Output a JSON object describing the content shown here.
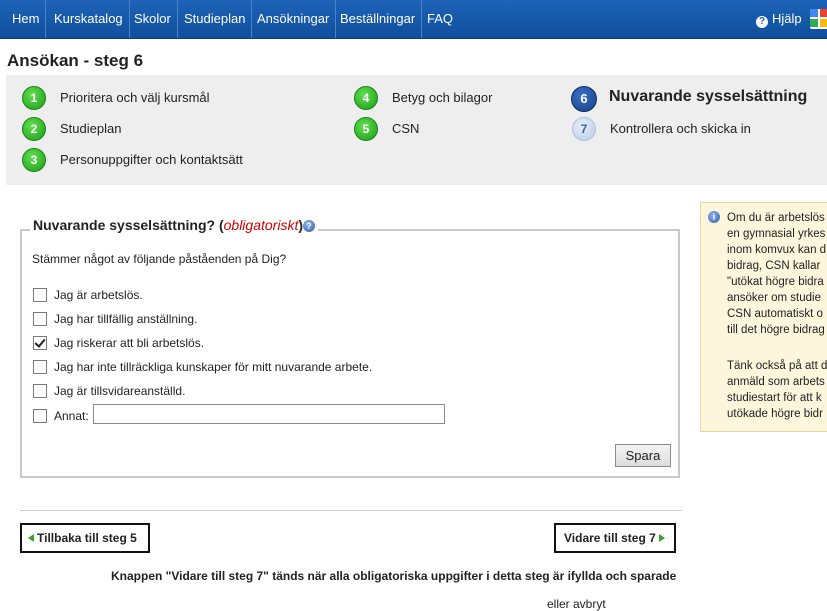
{
  "nav": {
    "items": [
      "Hem",
      "Kurskatalog",
      "Skolor",
      "Studieplan",
      "Ansökningar",
      "Beställningar",
      "FAQ"
    ],
    "help_label": "Hjälp",
    "help_icon": "question-circle-icon",
    "google_icon": "google-icon"
  },
  "page": {
    "title": "Ansökan - steg 6"
  },
  "steps": [
    {
      "number": "1",
      "label": "Prioritera och välj kursmål",
      "state": "done"
    },
    {
      "number": "2",
      "label": "Studieplan",
      "state": "done"
    },
    {
      "number": "3",
      "label": "Personuppgifter och kontaktsätt",
      "state": "done"
    },
    {
      "number": "4",
      "label": "Betyg och bilagor",
      "state": "done"
    },
    {
      "number": "5",
      "label": "CSN",
      "state": "done"
    },
    {
      "number": "6",
      "label": "Nuvarande sysselsättning",
      "state": "current"
    },
    {
      "number": "7",
      "label": "Kontrollera och skicka in",
      "state": "todo"
    }
  ],
  "form": {
    "legend": "Nuvarande sysselsättning? (",
    "legend_required": "obligatoriskt",
    "legend_end": ")",
    "question": "Stämmer något av följande påståenden på Dig?",
    "options": [
      {
        "label": "Jag är arbetslös.",
        "checked": false
      },
      {
        "label": "Jag har tillfällig anställning.",
        "checked": false
      },
      {
        "label": "Jag riskerar att bli arbetslös.",
        "checked": true
      },
      {
        "label": "Jag har inte tillräckliga kunskaper för mitt nuvarande arbete.",
        "checked": false
      },
      {
        "label": "Jag är tillsvidareanställd.",
        "checked": false
      },
      {
        "label": "Annat:",
        "checked": false
      }
    ],
    "other_value": "",
    "save_label": "Spara"
  },
  "info": {
    "lines": [
      "Om du är arbetslös",
      "en gymnasial yrkes",
      "inom komvux kan d",
      "bidrag, CSN kallar",
      "\"utökat högre bidra",
      "ansöker om studie",
      "CSN automatiskt o",
      "till det högre bidrag",
      "",
      "Tänk också på att d",
      "anmäld som arbets",
      "studiestart för att k",
      "utökade högre bidr"
    ]
  },
  "bottom": {
    "back_label": "Tillbaka till steg 5",
    "next_label": "Vidare till steg 7",
    "notice": "Knappen \"Vidare till steg 7\" tänds när alla obligatoriska uppgifter i detta steg är ifyllda och sparade",
    "cancel": "eller avbryt"
  }
}
